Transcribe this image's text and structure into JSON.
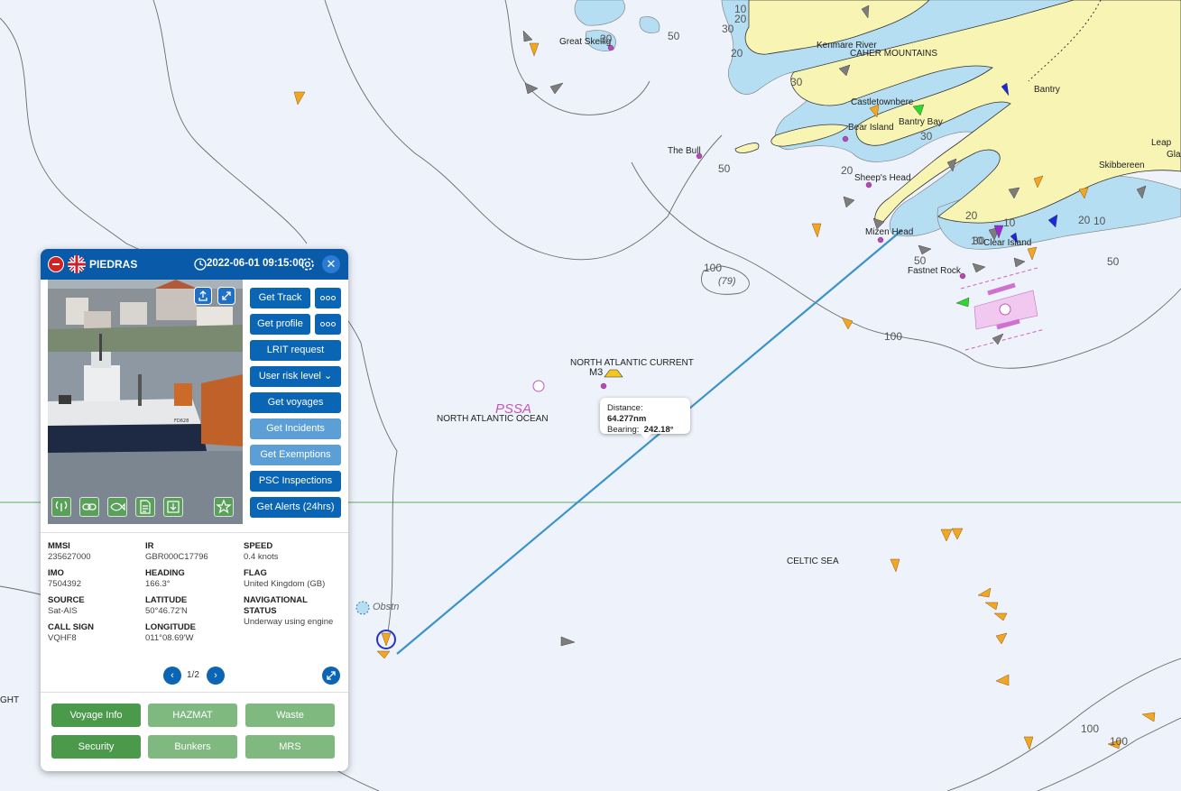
{
  "map": {
    "place_labels": [
      {
        "text": "Great Skellig"
      },
      {
        "text": "Kenmare River"
      },
      {
        "text": "CAHER MOUNTAINS"
      },
      {
        "text": "Castletownbere"
      },
      {
        "text": "Bantry"
      },
      {
        "text": "Bear Island"
      },
      {
        "text": "Bantry Bay"
      },
      {
        "text": "The Bull"
      },
      {
        "text": "Sheep's Head"
      },
      {
        "text": "Skibbereen"
      },
      {
        "text": "Leap"
      },
      {
        "text": "Gla"
      },
      {
        "text": "Mizen Head"
      },
      {
        "text": "Clear Island"
      },
      {
        "text": "Fastnet Rock"
      },
      {
        "text": "NORTH ATLANTIC CURRENT"
      },
      {
        "text": "M3"
      },
      {
        "text": "NORTH ATLANTIC OCEAN"
      },
      {
        "text": "CELTIC SEA"
      },
      {
        "text": "GHT"
      }
    ],
    "depth_labels": [
      "30",
      "50",
      "10",
      "20",
      "20",
      "30",
      "30",
      "20",
      "30",
      "10",
      "20",
      "10",
      "10",
      "20",
      "50",
      "30",
      "50",
      "50",
      "100",
      "100",
      "100",
      "100",
      "(79)"
    ],
    "pssa_label": "PSSA",
    "obstn_label": "Obstn",
    "colors": {
      "sea": "#eef2fb",
      "shallow": "#b5def3",
      "land": "#f8f4b4",
      "route": "#3a93c9",
      "grid": "#2a9a2a"
    }
  },
  "measure": {
    "distance_label": "Distance:",
    "distance_value": "64.277nm",
    "bearing_label": "Bearing:",
    "bearing_value": "242.18°"
  },
  "panel": {
    "vessel_name": "PIEDRAS",
    "timestamp": "2022-06-01 09:15:00",
    "flag_icon": "uk-flag-icon",
    "close_symbol": "✕",
    "photo_hull_text": "FD628",
    "actions": [
      {
        "label": "Get Track",
        "has_more": true
      },
      {
        "label": "Get profile",
        "has_more": true
      },
      {
        "label": "LRIT request",
        "has_more": false
      },
      {
        "label": "User risk level",
        "has_more": false,
        "dropdown": true
      },
      {
        "label": "Get voyages",
        "has_more": false
      },
      {
        "label": "Get Incidents",
        "has_more": false,
        "muted": true
      },
      {
        "label": "Get Exemptions",
        "has_more": false,
        "muted": true
      },
      {
        "label": "PSC Inspections",
        "has_more": false
      },
      {
        "label": "Get Alerts (24hrs)",
        "has_more": false
      }
    ],
    "info": {
      "mmsi": {
        "label": "MMSI",
        "value": "235627000"
      },
      "imo": {
        "label": "IMO",
        "value": "7504392"
      },
      "source": {
        "label": "SOURCE",
        "value": "Sat-AIS"
      },
      "call_sign": {
        "label": "CALL SIGN",
        "value": "VQHF8"
      },
      "ir": {
        "label": "IR",
        "value": "GBR000C17796"
      },
      "heading": {
        "label": "HEADING",
        "value": "166.3°"
      },
      "latitude": {
        "label": "LATITUDE",
        "value": "50°46.72'N"
      },
      "longitude": {
        "label": "LONGITUDE",
        "value": "011°08.69'W"
      },
      "speed": {
        "label": "SPEED",
        "value": "0.4 knots"
      },
      "flag": {
        "label": "FLAG",
        "value": "United Kingdom (GB)"
      },
      "nav_status": {
        "label": "NAVIGATIONAL STATUS",
        "value": "Underway using engine"
      }
    },
    "pager": {
      "text": "1/2",
      "prev": "‹",
      "next": "›"
    },
    "tabs": [
      {
        "label": "Voyage Info",
        "active": true
      },
      {
        "label": "HAZMAT",
        "active": false
      },
      {
        "label": "Waste",
        "active": false
      },
      {
        "label": "Security",
        "active": true
      },
      {
        "label": "Bunkers",
        "active": false
      },
      {
        "label": "MRS",
        "active": false
      }
    ]
  }
}
